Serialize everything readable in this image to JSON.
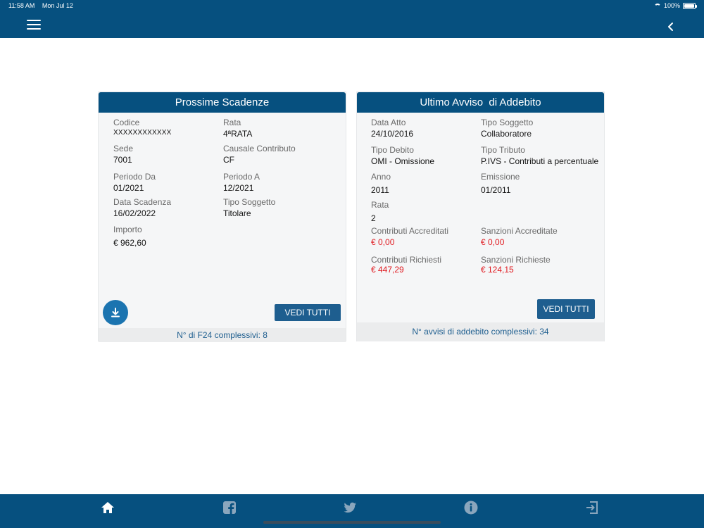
{
  "status_bar": {
    "time": "11:58 AM",
    "date": "Mon Jul 12",
    "battery": "100%"
  },
  "header": {
    "menu_icon": "hamburger-icon",
    "back_icon": "chevron-left-icon"
  },
  "scadenze": {
    "title": "Prossime Scadenze",
    "codice_label": "Codice",
    "codice_value": "XXXXXXXXXXXX",
    "rata_label": "Rata",
    "rata_value": "4ªRATA",
    "sede_label": "Sede",
    "sede_value": "7001",
    "causale_label": "Causale Contributo",
    "causale_value": "CF",
    "periodo_da_label": "Periodo Da",
    "periodo_da_value": "01/2021",
    "periodo_a_label": "Periodo A",
    "periodo_a_value": "12/2021",
    "data_scadenza_label": "Data Scadenza",
    "data_scadenza_value": "16/02/2022",
    "tipo_soggetto_label": "Tipo Soggetto",
    "tipo_soggetto_value": "Titolare",
    "importo_label": "Importo",
    "importo_value": "€ 962,60",
    "download_icon": "download-icon",
    "vedi_tutti": "VEDI TUTTI",
    "footer": "N° di F24 complessivi: 8"
  },
  "avviso": {
    "title": "Ultimo Avviso  di Addebito",
    "data_atto_label": "Data Atto",
    "data_atto_value": "24/10/2016",
    "tipo_soggetto_label": "Tipo Soggetto",
    "tipo_soggetto_value": "Collaboratore",
    "tipo_debito_label": "Tipo Debito",
    "tipo_debito_value": "OMI - Omissione",
    "tipo_tributo_label": "Tipo Tributo",
    "tipo_tributo_value": "P.IVS - Contributi a percentuale",
    "anno_label": "Anno",
    "anno_value": "2011",
    "emissione_label": "Emissione",
    "emissione_value": "01/2011",
    "rata_label": "Rata",
    "rata_value": "2",
    "contributi_accreditati_label": "Contributi Accreditati",
    "contributi_accreditati_value": "€ 0,00",
    "sanzioni_accreditate_label": "Sanzioni Accreditate",
    "sanzioni_accreditate_value": "€ 0,00",
    "contributi_richiesti_label": "Contributi Richiesti",
    "contributi_richiesti_value": "€ 447,29",
    "sanzioni_richieste_label": "Sanzioni Richieste",
    "sanzioni_richieste_value": "€ 124,15",
    "vedi_tutti": "VEDI TUTTI",
    "footer": "N° avvisi di addebito complessivi: 34"
  },
  "tabbar": {
    "icons": [
      "home-icon",
      "facebook-icon",
      "twitter-icon",
      "info-icon",
      "logout-icon"
    ]
  },
  "colors": {
    "primary": "#06507f",
    "button": "#1e5e8f",
    "accent_red": "#e0191f"
  }
}
